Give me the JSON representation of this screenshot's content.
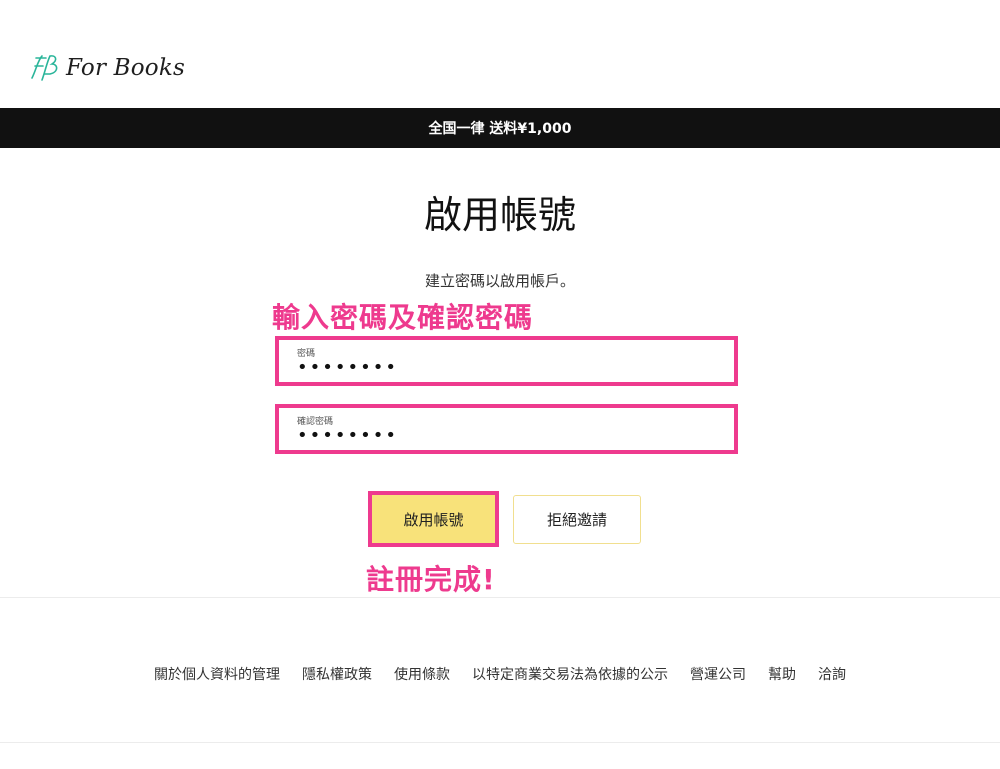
{
  "header": {
    "logo_text": "For Books",
    "logo_color": "#2ab59a"
  },
  "announcement": {
    "text": "全国一律 送料¥1,000"
  },
  "main": {
    "title": "啟用帳號",
    "subtitle": "建立密碼以啟用帳戶。",
    "password_field": {
      "label": "密碼",
      "value": "••••••••"
    },
    "confirm_field": {
      "label": "確認密碼",
      "value": "••••••••"
    },
    "activate_button": "啟用帳號",
    "decline_button": "拒絕邀請"
  },
  "annotations": {
    "enter_password": "輸入密碼及確認密碼",
    "done": "註冊完成!",
    "color": "#ee3a8e"
  },
  "footer": {
    "links": [
      "關於個人資料的管理",
      "隱私權政策",
      "使用條款",
      "以特定商業交易法為依據的公示",
      "營運公司",
      "幫助",
      "洽詢"
    ]
  },
  "colors": {
    "accent_yellow": "#f8e27a",
    "announcement_bg": "#111111"
  }
}
